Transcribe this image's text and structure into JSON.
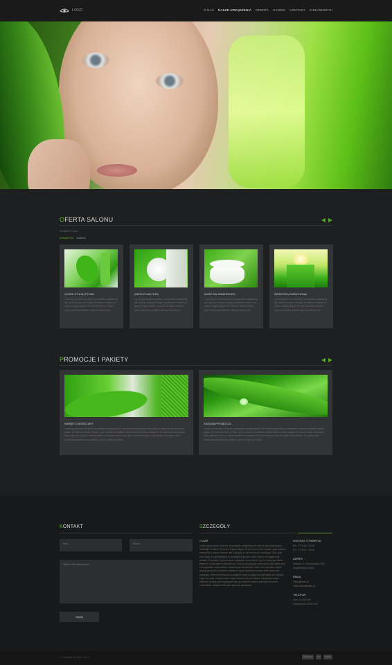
{
  "header": {
    "logo_text": "LOGO",
    "nav": [
      "O NAS",
      "NASZE URZĄDZENIA",
      "OFERTA",
      "CENNIK",
      "KONTAKT",
      "CIEKAWOSTKI"
    ],
    "active_nav_index": 1
  },
  "oferta": {
    "title_first": "O",
    "title_rest": "FERTA SALONU",
    "breadcrumb": "WYBIERZ DZIAŁ",
    "filters": [
      "KOSMETYKI",
      "ZABIEGI"
    ],
    "cards": [
      {
        "title": "OLDEK Z EKALIPTUSA",
        "text": "Lorem ipsum dolor sit amet, consectetur adipiscing elit, sed do eiusmod tempor incididunt ut labore et dolore magna aliqua. Ut enim ad minim veniam, quis nostrud exercitation ullamco laboris nisi"
      },
      {
        "title": "KREM Z KAKTUSA",
        "text": "Lorem ipsum dolor sit amet, consectetur adipiscing elit, sed do eiusmod tempor incididunt ut labore et dolore magna aliqua. Ut enim ad minim veniam, quis nostrud exercitation ullamco laboris nisi"
      },
      {
        "title": "MAŚĆ NA ZMARSZCZKI",
        "text": "Lorem ipsum dolor sit amet, consectetur adipiscing elit, sed do eiusmod tempor incididunt ut labore et dolore magna aliqua. Ut enim ad minim veniam, quis nostrud exercitation ullamco laboris nisi"
      },
      {
        "title": "ŚWIECZKA ZAPACHOWA",
        "text": "Lorem ipsum dolor sit amet, consectetur adipiscing elit, sed do eiusmod tempor incididunt ut labore et dolore magna aliqua. Ut enim ad minim veniam, quis nostrud exercitation ullamco laboris nisi"
      }
    ]
  },
  "promocje": {
    "title_first": "P",
    "title_rest": "ROMOCJE I PAKIETY",
    "items": [
      {
        "title": "KARNET MIESIĘCZNY",
        "text": "Lorem ipsum dolor sit amet, consectetur adipiscing elit, sed do eiusmod tempor incididunt ut labore et dolore magna aliqua. Ut enim ad minim veniam, quis nostrud exercitation ullamco laboris nisi ut aliquip ex ea commodo consequat. Duis aute irure dolor in reprehenderit in voluptate velit esse cillum dolore eu fugiat nulla pariatur. Excepteur sint occaecat cupidatat non proident, sunt in culpa qui officia"
      },
      {
        "title": "ZIMOWA PROMOCJA",
        "text": "Lorem ipsum dolor sit amet, consectetur adipiscing elit, sed do eiusmod tempor incididunt ut labore et dolore magna aliqua. Ut enim ad minim veniam, quis nostrud exercitation ullamco laboris nisi ut aliquip ex ea commodo consequat. Duis aute irure dolor in reprehenderit in voluptate velit esse cillum dolore eu fugiat nulla pariatur. Excepteur sint occaecat cupidatat non proident, sunt in culpa qui officia"
      }
    ]
  },
  "kontakt": {
    "title_first": "K",
    "title_rest": "ONTAKT",
    "name_placeholder": "Imię...",
    "email_placeholder": "Email...",
    "message_placeholder": "Wpisz treść wiadomości...",
    "submit_label": "Wyślij"
  },
  "szczegoly": {
    "title_first": "S",
    "title_rest": "ZCZEGÓŁY",
    "about_title": "O NAS",
    "about_text": "Lorem ipsum dolor sit amet, consectetur adipiscing elit, sed do eiusmod tempor incididunt ut labore et dolore magna aliqua. Ut enim ad minim veniam, quis nostrud exercitation ullamco laboris nisi ut aliquip ex ea commodo consequat. Duis aute irure dolor in reprehenderit in voluptate velit esse cillum dolore eu fugiat nulla pariatur. Excepteur sint occaecat cupidatat non proident, sunt in culpa qui officia deserunt mollit anim id est laborum. Sed ut perspiciatis unde omnis iste natus error sit voluptatem accusantium doloremque laudantium, totam rem aperiam, eaque ipsa quae ab illo inventore veritatis et quasi architecto beatae vitae dicta sunt explicabo. Nemo enim ipsam voluptatem quia voluptas sit aspernatur aut odit aut fugit, sed quia consequuntur magni dolores eos qui ratione voluptatem sequi nesciunt. Neque porro quisquam est, qui dolorem ipsum quia dolor sit amet, consectetur, adipisci velit, sed quia non numquam",
    "hours_title": "GODZINY OTWARCIA",
    "hours": [
      "PN - PT 8:10 - 22:00",
      "PN - PT 8:00 - 20:00"
    ],
    "address_title": "ADRES",
    "address": [
      "Koszalin ul. Grunwaldzka 18/2",
      "Województwo Kaniu"
    ],
    "email_title": "EMAIL",
    "emails": [
      "Tissie@wlan.pl",
      "Tissie.ziena@wlan.pl"
    ],
    "phone_title": "TELEFON",
    "phones": [
      "Kom. 64 000 000",
      "Stacjonarny 64 000 000"
    ]
  },
  "footer": {
    "copyright": "© Copyright by Salon Urody",
    "social": [
      "Facebook",
      "G+",
      "Twitter"
    ]
  },
  "colors": {
    "accent": "#5cbf2a",
    "background": "#1e1f21",
    "card": "#333436"
  }
}
